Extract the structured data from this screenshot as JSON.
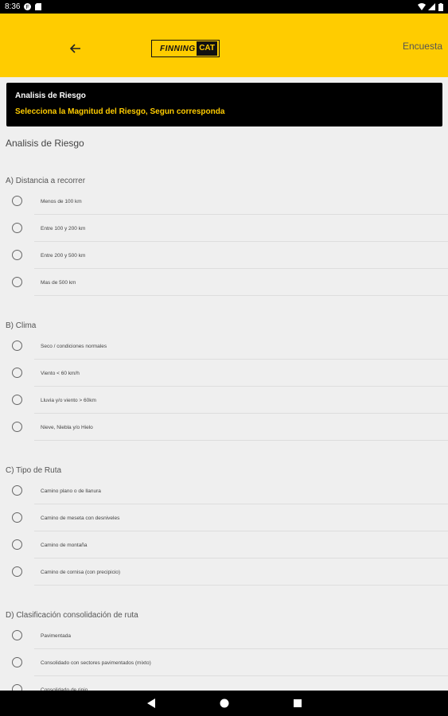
{
  "status_bar": {
    "time": "8:36"
  },
  "app_bar": {
    "logo_text": "FINNING",
    "logo_badge": "CAT",
    "action_label": "Encuesta"
  },
  "banner": {
    "title": "Analisis de Riesgo",
    "subtitle": "Selecciona la Magnitud del Riesgo, Segun corresponda"
  },
  "section_title": "Analisis de Riesgo",
  "questions": [
    {
      "title": "A) Distancia a recorrer",
      "options": [
        "Menos de 100 km",
        "Entre 100 y 200 km",
        "Entre 200 y 500 km",
        "Mas de 500 km"
      ]
    },
    {
      "title": "B) Clima",
      "options": [
        "Seco / condiciones normales",
        "Viento < 60 km/h",
        "Lluvia y/o viento > 60km",
        "Nieve, Niebla y/o Hielo"
      ]
    },
    {
      "title": "C) Tipo de Ruta",
      "options": [
        "Camino plano o de llanura",
        "Camino de meseta con desniveles",
        "Camino de montaña",
        "Camino de cornisa (con precipicio)"
      ]
    },
    {
      "title": "D) Clasificación consolidación de ruta",
      "options": [
        "Pavimentada",
        "Consolidado con sectores pavimentados (mixto)",
        "Consolidado de ripio"
      ]
    }
  ],
  "colors": {
    "brand_yellow": "#ffcc00",
    "banner_bg": "#000000",
    "page_bg": "#efefef"
  }
}
